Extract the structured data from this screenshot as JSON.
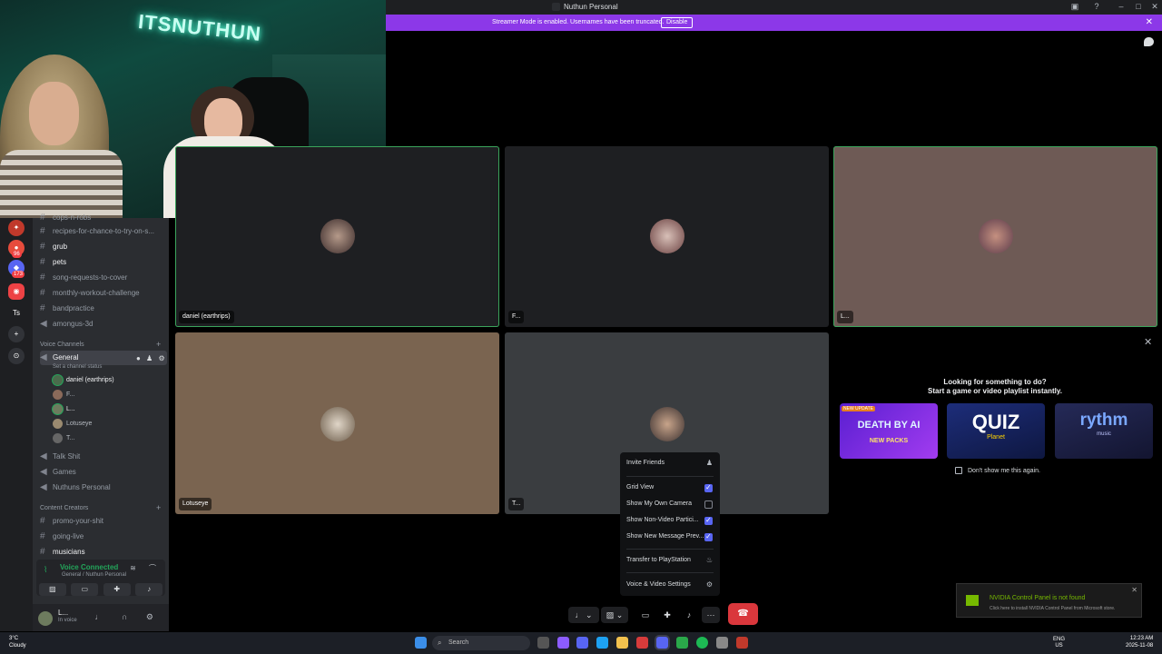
{
  "window": {
    "title": "Nuthun Personal"
  },
  "banner": {
    "message": "Streamer Mode is enabled. Usernames have been truncated.",
    "disable_label": "Disable"
  },
  "webcam": {
    "neon_sign": "ITSNUTHUN"
  },
  "rail": {
    "badges": [
      "96",
      "173"
    ],
    "text_server": "Ts"
  },
  "channels": [
    {
      "name": "cops-n-robs",
      "icon": "hash"
    },
    {
      "name": "recipes-for-chance-to-try-on-s...",
      "icon": "hash"
    },
    {
      "name": "grub",
      "icon": "hash",
      "bold": true
    },
    {
      "name": "pets",
      "icon": "hash",
      "bold": true
    },
    {
      "name": "song-requests-to-cover",
      "icon": "hash"
    },
    {
      "name": "monthly-workout-challenge",
      "icon": "hash"
    },
    {
      "name": "bandpractice",
      "icon": "hash"
    },
    {
      "name": "amongus-3d",
      "icon": "speaker"
    }
  ],
  "voice_category": "Voice Channels",
  "general": {
    "name": "General",
    "status": "Set a channel status"
  },
  "voice_users": [
    "daniel (earthrips)",
    "F...",
    "L...",
    "Lotuseye",
    "T..."
  ],
  "voice_channels_more": [
    "Talk Shit",
    "Games",
    "Nuthuns Personal"
  ],
  "content_category": "Content Creators",
  "content_channels": [
    "promo-your-shit",
    "going-live",
    "musicians"
  ],
  "voice_connected": {
    "title": "Voice Connected",
    "sub": "General / Nuthun Personal"
  },
  "user": {
    "name": "L...",
    "status": "In voice"
  },
  "tiles": [
    {
      "label": "daniel (earthrips)",
      "bg": "#1e1f22",
      "speaking": true
    },
    {
      "label": "F...",
      "bg": "#1e1f22",
      "speaking": false
    },
    {
      "label": "L...",
      "bg": "#6e5a55",
      "speaking": true
    },
    {
      "label": "Lotuseye",
      "bg": "#7a6450",
      "speaking": false
    },
    {
      "label": "T...",
      "bg": "#3a3d40",
      "speaking": false
    }
  ],
  "activity": {
    "line1": "Looking for something to do?",
    "line2": "Start a game or video playlist instantly.",
    "cards": [
      {
        "title": "DEATH BY AI",
        "badge": "NEW UPDATE",
        "sub": "NEW PACKS",
        "color": "#7b2ff7"
      },
      {
        "title": "QUIZ",
        "sub": "Planet",
        "color": "#1c2a6e"
      },
      {
        "title": "rythm",
        "sub": "music",
        "color": "#1b1d3a"
      }
    ],
    "dont_show": "Don't show me this again."
  },
  "menu": {
    "invite": "Invite Friends",
    "items": [
      {
        "label": "Grid View",
        "checked": true
      },
      {
        "label": "Show My Own Camera",
        "checked": false
      },
      {
        "label": "Show Non-Video Partici...",
        "checked": true
      },
      {
        "label": "Show New Message Prev...",
        "checked": true
      }
    ],
    "transfer": "Transfer to PlayStation",
    "settings": "Voice & Video Settings"
  },
  "toast": {
    "title": "NVIDIA Control Panel is not found",
    "body": "Click here to install NVIDIA Control Panel from Microsoft store."
  },
  "taskbar": {
    "temp": "3°C",
    "weather": "Cloudy",
    "search": "Search",
    "lang": "ENG",
    "region": "US",
    "time": "12:23 AM",
    "date": "2025-11-08"
  }
}
